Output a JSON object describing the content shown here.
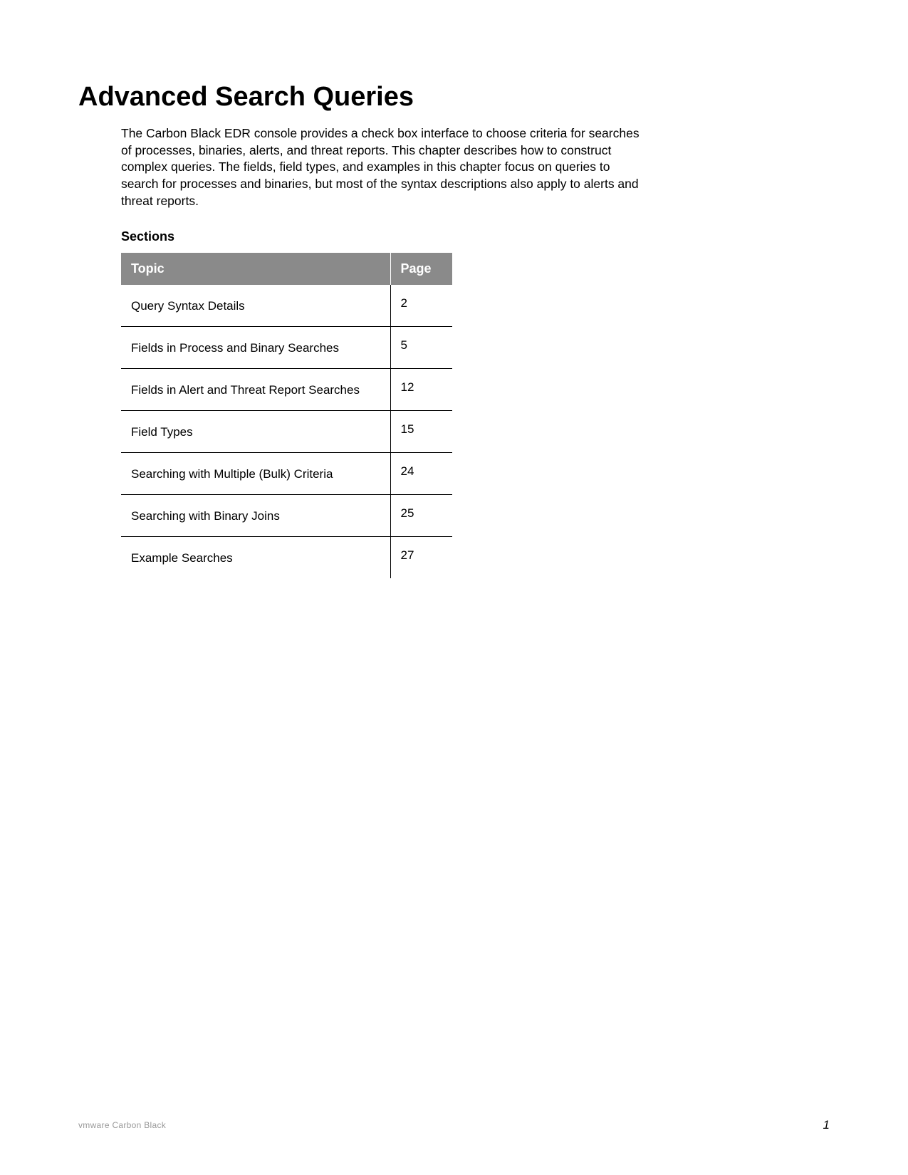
{
  "title": "Advanced Search Queries",
  "intro": "The Carbon Black EDR console provides a check box interface to choose criteria for searches of processes, binaries, alerts, and threat reports. This chapter describes how to construct complex queries. The fields, field types, and examples in this chapter focus on queries to search for processes and binaries, but most of the syntax descriptions also apply to alerts and threat reports.",
  "sectionsHeading": "Sections",
  "table": {
    "headers": {
      "topic": "Topic",
      "page": "Page"
    },
    "rows": [
      {
        "topic": "Query Syntax Details",
        "page": "2"
      },
      {
        "topic": "Fields in Process and Binary Searches",
        "page": "5"
      },
      {
        "topic": "Fields in Alert and Threat Report Searches",
        "page": "12"
      },
      {
        "topic": "Field Types",
        "page": "15"
      },
      {
        "topic": "Searching with Multiple (Bulk) Criteria",
        "page": "24"
      },
      {
        "topic": "Searching with Binary Joins",
        "page": "25"
      },
      {
        "topic": "Example Searches",
        "page": "27"
      }
    ]
  },
  "footer": {
    "brand": "vmware Carbon Black",
    "pageNumber": "1"
  }
}
